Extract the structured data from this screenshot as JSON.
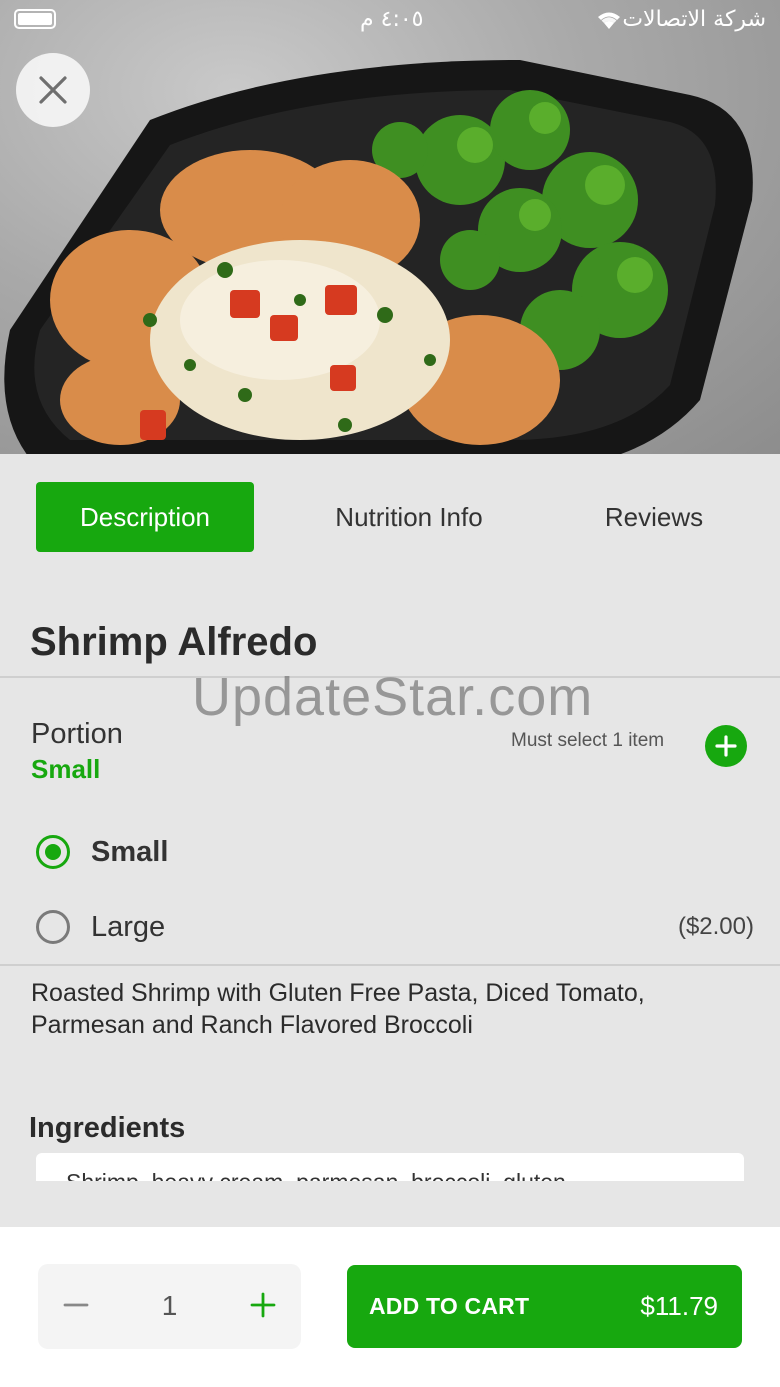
{
  "status_bar": {
    "time": "٤:٠٥ م",
    "carrier": "شركة الاتصالات"
  },
  "tabs": [
    {
      "label": "Description",
      "active": true
    },
    {
      "label": "Nutrition Info",
      "active": false
    },
    {
      "label": "Reviews",
      "active": false
    }
  ],
  "product": {
    "title": "Shrimp Alfredo",
    "description": "Roasted Shrimp with Gluten Free Pasta, Diced Tomato, Parmesan and Ranch Flavored Broccoli"
  },
  "watermark": "UpdateStar.com",
  "portion": {
    "label": "Portion",
    "selected": "Small",
    "requirement": "Must select 1 item",
    "options": [
      {
        "label": "Small",
        "price": "",
        "checked": true
      },
      {
        "label": "Large",
        "price": "($2.00)",
        "checked": false
      }
    ]
  },
  "ingredients": {
    "title": "Ingredients",
    "text": "Shrimp, heavy cream, parmesan, broccoli, gluten"
  },
  "cart": {
    "quantity": "1",
    "button_label": "ADD TO CART",
    "price": "$11.79"
  },
  "colors": {
    "accent": "#17a80f",
    "background": "#e6e6e6"
  }
}
